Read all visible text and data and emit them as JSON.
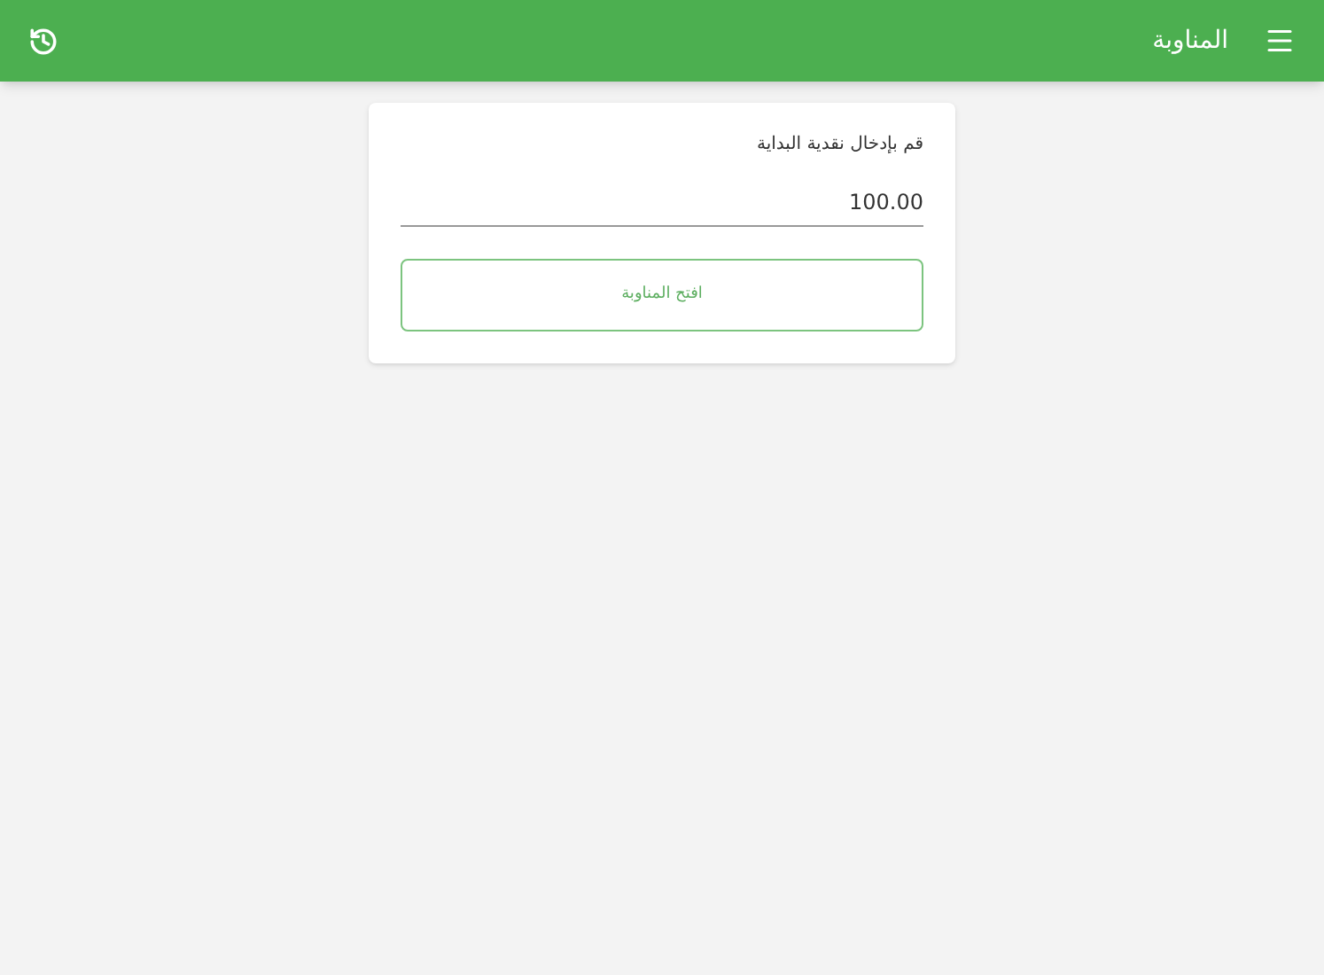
{
  "app_bar": {
    "title": "المناوبة"
  },
  "card": {
    "label": "قم بإدخال نقدية البداية",
    "amount_field": {
      "value": "100.00"
    },
    "open_button": "افتح المناوبة"
  }
}
